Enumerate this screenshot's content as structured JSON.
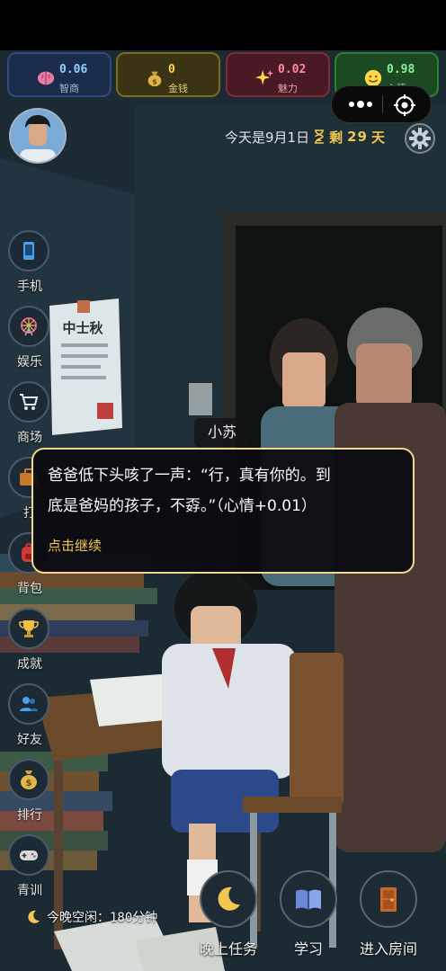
{
  "stats": [
    {
      "id": "iq",
      "value": "0.06",
      "label": "智商",
      "icon": "brain-icon",
      "color": "#8ed0ff"
    },
    {
      "id": "money",
      "value": "0",
      "label": "金钱",
      "icon": "money-bag-icon",
      "color": "#ffd84a"
    },
    {
      "id": "charm",
      "value": "0.02",
      "label": "魅力",
      "icon": "sparkle-icon",
      "color": "#ff8aa0"
    },
    {
      "id": "mood",
      "value": "0.98",
      "label": "心情",
      "icon": "smile-icon",
      "color": "#8cf09a"
    }
  ],
  "header": {
    "date_text": "今天是9月1日",
    "remaining_prefix": "剩",
    "remaining_days": "29",
    "remaining_suffix": "天"
  },
  "sidebar": {
    "items": [
      {
        "label": "手机",
        "icon": "phone-icon"
      },
      {
        "label": "娱乐",
        "icon": "ferris-wheel-icon"
      },
      {
        "label": "商场",
        "icon": "cart-icon"
      },
      {
        "label": "打",
        "icon": "briefcase-icon"
      },
      {
        "label": "背包",
        "icon": "backpack-icon"
      },
      {
        "label": "成就",
        "icon": "trophy-icon"
      },
      {
        "label": "好友",
        "icon": "friends-icon"
      },
      {
        "label": "排行",
        "icon": "money-bag-icon"
      },
      {
        "label": "青训",
        "icon": "gamepad-icon"
      }
    ]
  },
  "dialog": {
    "speaker": "小苏",
    "line1": "爸爸低下头咳了一声：“行，真有你的。到",
    "line2": "底是爸妈的孩子，不孬。”（心情+0.01）",
    "continue": "点击继续"
  },
  "scene_poster": {
    "title": "中士秋"
  },
  "footer": {
    "free_time": "今晚空闲：180分钟"
  },
  "bottom_buttons": [
    {
      "label": "晚上任务",
      "icon": "moon-icon"
    },
    {
      "label": "学习",
      "icon": "book-icon"
    },
    {
      "label": "进入房间",
      "icon": "door-icon"
    }
  ],
  "colors": {
    "accent_gold": "#f3c74f",
    "dialog_border": "#f1d88e"
  }
}
